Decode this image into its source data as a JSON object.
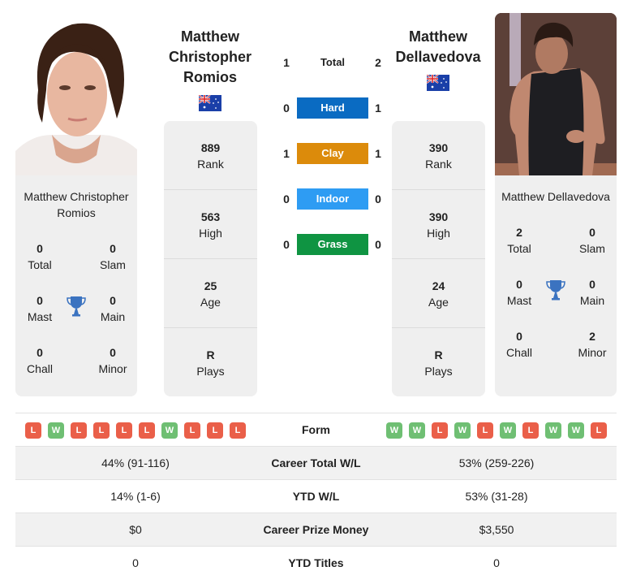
{
  "colors": {
    "hard": "#0a6bc2",
    "clay": "#dc8b0b",
    "indoor": "#2e9cf3",
    "grass": "#0f9442",
    "win": "#6fbf73",
    "loss": "#ea5f49",
    "trophy": "#3b73c0"
  },
  "player1": {
    "name_heading": [
      "Matthew",
      "Christopher",
      "Romios"
    ],
    "card_name": "Matthew Christopher Romios",
    "country_flag": "australia-flag",
    "stats": [
      {
        "value": "889",
        "label": "Rank"
      },
      {
        "value": "563",
        "label": "High"
      },
      {
        "value": "25",
        "label": "Age"
      },
      {
        "value": "R",
        "label": "Plays"
      }
    ],
    "titles": {
      "total": {
        "value": "0",
        "label": "Total"
      },
      "slam": {
        "value": "0",
        "label": "Slam"
      },
      "mast": {
        "value": "0",
        "label": "Mast"
      },
      "main": {
        "value": "0",
        "label": "Main"
      },
      "chall": {
        "value": "0",
        "label": "Chall"
      },
      "minor": {
        "value": "0",
        "label": "Minor"
      }
    },
    "form": [
      "L",
      "W",
      "L",
      "L",
      "L",
      "L",
      "W",
      "L",
      "L",
      "L"
    ]
  },
  "player2": {
    "name_heading": [
      "Matthew",
      "Dellavedova"
    ],
    "card_name": "Matthew Dellavedova",
    "country_flag": "australia-flag",
    "stats": [
      {
        "value": "390",
        "label": "Rank"
      },
      {
        "value": "390",
        "label": "High"
      },
      {
        "value": "24",
        "label": "Age"
      },
      {
        "value": "R",
        "label": "Plays"
      }
    ],
    "titles": {
      "total": {
        "value": "2",
        "label": "Total"
      },
      "slam": {
        "value": "0",
        "label": "Slam"
      },
      "mast": {
        "value": "0",
        "label": "Mast"
      },
      "main": {
        "value": "0",
        "label": "Main"
      },
      "chall": {
        "value": "0",
        "label": "Chall"
      },
      "minor": {
        "value": "2",
        "label": "Minor"
      }
    },
    "form": [
      "W",
      "W",
      "L",
      "W",
      "L",
      "W",
      "L",
      "W",
      "W",
      "L"
    ]
  },
  "h2h": [
    {
      "label": "Total",
      "left": "1",
      "right": "2",
      "surface": "total"
    },
    {
      "label": "Hard",
      "left": "0",
      "right": "1",
      "surface": "hard"
    },
    {
      "label": "Clay",
      "left": "1",
      "right": "1",
      "surface": "clay"
    },
    {
      "label": "Indoor",
      "left": "0",
      "right": "0",
      "surface": "indoor"
    },
    {
      "label": "Grass",
      "left": "0",
      "right": "0",
      "surface": "grass"
    }
  ],
  "comparison": {
    "form_label": "Form",
    "rows": [
      {
        "label": "Career Total W/L",
        "left": "44% (91-116)",
        "right": "53% (259-226)"
      },
      {
        "label": "YTD W/L",
        "left": "14% (1-6)",
        "right": "53% (31-28)"
      },
      {
        "label": "Career Prize Money",
        "left": "$0",
        "right": "$3,550"
      },
      {
        "label": "YTD Titles",
        "left": "0",
        "right": "0"
      }
    ]
  }
}
